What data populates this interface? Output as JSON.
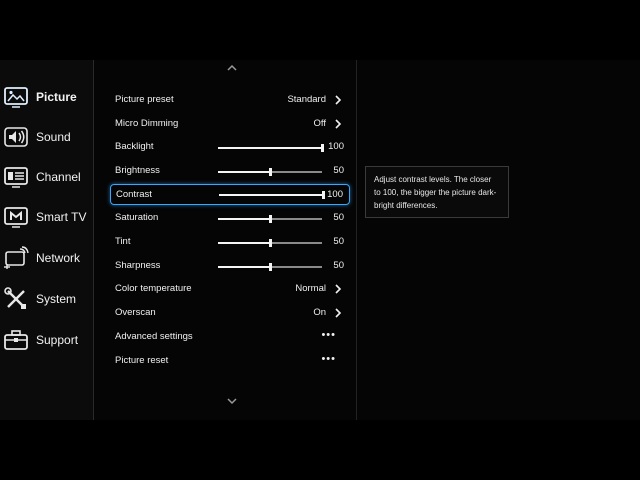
{
  "sidebar": {
    "items": [
      {
        "label": "Picture",
        "icon": "picture-icon"
      },
      {
        "label": "Sound",
        "icon": "sound-icon"
      },
      {
        "label": "Channel",
        "icon": "channel-icon"
      },
      {
        "label": "Smart TV",
        "icon": "smart-tv-icon"
      },
      {
        "label": "Network",
        "icon": "network-icon"
      },
      {
        "label": "System",
        "icon": "system-icon"
      },
      {
        "label": "Support",
        "icon": "support-icon"
      }
    ],
    "active": "Picture"
  },
  "settings": {
    "picture_preset": {
      "label": "Picture preset",
      "value": "Standard"
    },
    "micro_dimming": {
      "label": "Micro Dimming",
      "value": "Off"
    },
    "backlight": {
      "label": "Backlight",
      "value": "100",
      "level": 1.0
    },
    "brightness": {
      "label": "Brightness",
      "value": "50",
      "level": 0.5
    },
    "contrast": {
      "label": "Contrast",
      "value": "100",
      "level": 1.0
    },
    "saturation": {
      "label": "Saturation",
      "value": "50",
      "level": 0.5
    },
    "tint": {
      "label": "Tint",
      "value": "50",
      "level": 0.5
    },
    "sharpness": {
      "label": "Sharpness",
      "value": "50",
      "level": 0.5
    },
    "color_temperature": {
      "label": "Color temperature",
      "value": "Normal"
    },
    "overscan": {
      "label": "Overscan",
      "value": "On"
    },
    "advanced_settings": {
      "label": "Advanced settings",
      "value": "•••"
    },
    "picture_reset": {
      "label": "Picture reset",
      "value": "•••"
    }
  },
  "help": {
    "text": "Adjust contrast levels. The closer to 100, the bigger the picture dark-bright differences."
  },
  "colors": {
    "accent": "#35a8ff",
    "background": "#000000",
    "text": "#f0f0f0"
  }
}
